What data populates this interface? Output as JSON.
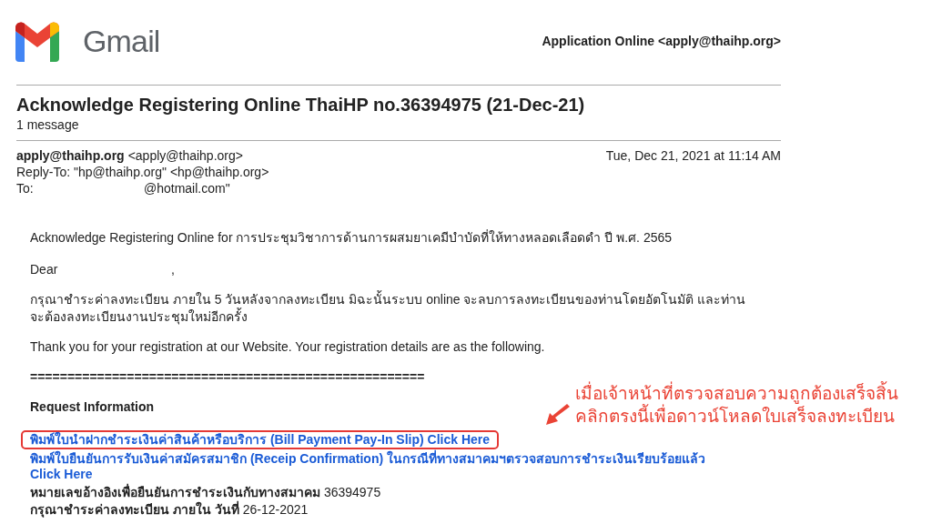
{
  "header": {
    "brand": "Gmail",
    "sender": "Application Online <apply@thaihp.org>"
  },
  "subject": "Acknowledge Registering Online ThaiHP no.36394975 (21-Dec-21)",
  "message_count": "1 message",
  "from": {
    "name": "apply@thaihp.org",
    "address": "<apply@thaihp.org>"
  },
  "date": "Tue, Dec 21, 2021 at 11:14 AM",
  "reply_to": "Reply-To: \"hp@thaihp.org\" <hp@thaihp.org>",
  "to": {
    "label": "To:",
    "address": "@hotmail.com\""
  },
  "body": {
    "intro": "Acknowledge Registering Online for การประชุมวิชาการด้านการผสมยาเคมีบำบัดที่ให้ทางหลอดเลือดดำ ปี พ.ศ. 2565",
    "greeting": "Dear",
    "greeting_comma": ",",
    "notice": "กรุณาชำระค่าลงทะเบียน ภายใน 5 วันหลังจากลงทะเบียน มิฉะนั้นระบบ online จะลบการลงทะเบียนของท่านโดยอัตโนมัติ และท่านจะต้องลงทะเบียนงานประชุมใหม่อีกครั้ง",
    "thanks": "Thank you for your registration at our Website. Your registration details are as the following.",
    "separator": "=====================================================",
    "request_heading": "Request Information",
    "links": [
      {
        "text": "พิมพ์ใบนำฝากชำระเงินค่าสินค้าหรือบริการ (Bill Payment Pay-In Slip) Click Here",
        "highlighted": true
      },
      {
        "text": "พิมพ์ใบยืนยันการรับเงินค่าสมัครสมาชิก (Receip Confirmation) ในกรณีที่ทางสมาคมฯตรวจสอบการชำระเงินเรียบร้อยแล้ว Click Here",
        "highlighted": false
      }
    ],
    "details": [
      "**หมายเลขอ้างอิงเพื่อยืนยันการชำระเงินกับทางสมาคม** 36394975",
      "**กรุณาชำระค่าลงทะเบียน ภายใน วันที่** 26-12-2021"
    ]
  },
  "annotation": {
    "lines": [
      "เมื่อเจ้าหน้าที่ตรวจสอบความถูกต้องเสร็จสิ้น",
      "คลิกตรงนี้เพื่อดาวน์โหลดใบเสร็จลงทะเบียน"
    ]
  }
}
